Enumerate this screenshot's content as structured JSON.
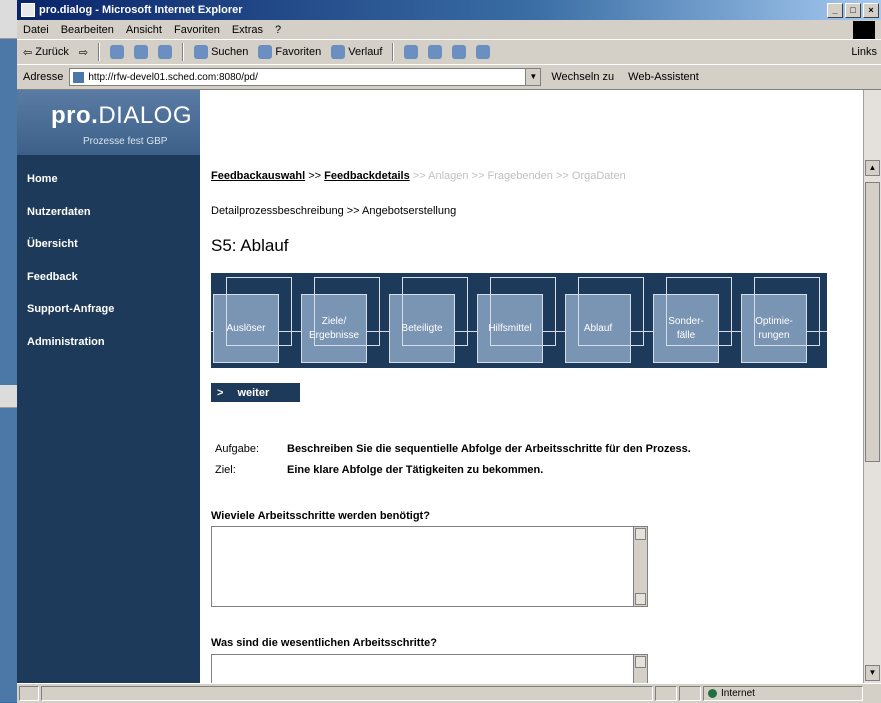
{
  "window": {
    "title": "pro.dialog - Microsoft Internet Explorer",
    "controls": [
      "_",
      "□",
      "×"
    ]
  },
  "menubar": {
    "items": [
      "Datei",
      "Bearbeiten",
      "Ansicht",
      "Favoriten",
      "Extras",
      "?"
    ]
  },
  "toolbar": {
    "back": "Zurück",
    "search": "Suchen",
    "favorites": "Favoriten",
    "history": "Verlauf",
    "links": "Links"
  },
  "address": {
    "label": "Adresse",
    "url": "http://rfw-devel01.sched.com:8080/pd/",
    "go": "Wechseln zu",
    "webassist": "Web-Assistent"
  },
  "sidebar": {
    "logo_bold": "pro.",
    "logo_light": "DIALOG",
    "tagline": "Prozesse fest GBP",
    "nav": [
      "Home",
      "Nutzerdaten",
      "Übersicht",
      "Feedback",
      "Support-Anfrage",
      "Administration"
    ]
  },
  "content": {
    "crumb_links": [
      "Feedbackauswahl",
      "Feedbackdetails"
    ],
    "crumb_sep": ">>",
    "crumb_gray": [
      "Anlagen",
      "Fragebenden",
      "OrgaDaten"
    ],
    "crumb2": "Detailprozessbeschreibung >> Angebotserstellung",
    "title": "S5: Ablauf",
    "steps": [
      "Auslöser",
      "Ziele/\nErgebnisse",
      "Beteiligte",
      "Hilfsmittel",
      "Ablauf",
      "Sonder-\nfälle",
      "Optimie-\nrungen"
    ],
    "weiter_arrow": ">",
    "weiter": "weiter",
    "task_label": "Aufgabe:",
    "task_text": "Beschreiben Sie die sequentielle Abfolge der Arbeitsschritte für den Prozess.",
    "goal_label": "Ziel:",
    "goal_text": "Eine klare Abfolge der Tätigkeiten zu bekommen.",
    "q1": "Wieviele Arbeitsschritte werden benötigt?",
    "q2": "Was sind die wesentlichen Arbeitsschritte?"
  },
  "statusbar": {
    "zone": "Internet"
  }
}
